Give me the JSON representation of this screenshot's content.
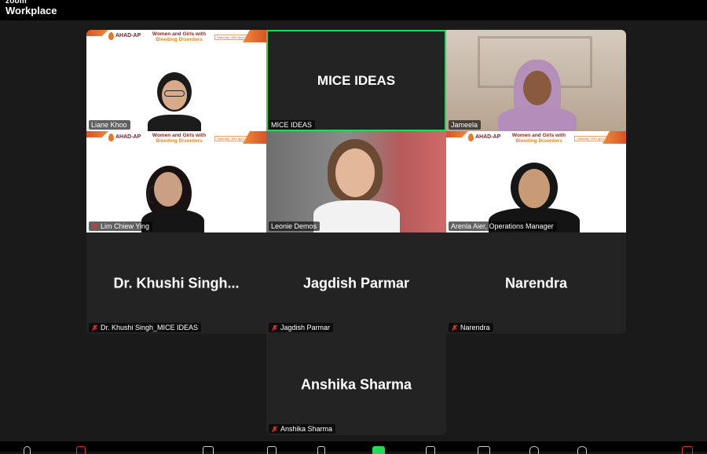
{
  "app": {
    "logo_line1": "zoom",
    "logo_line2": "Workplace"
  },
  "banner": {
    "org": "AHAD-AP",
    "title_line1": "Women and Girls with",
    "title_line2": "Bleeding Disorders",
    "date": "Saturday, 30th April 2024"
  },
  "participants": [
    {
      "name": "Liane Khoo",
      "muted": false,
      "video": true
    },
    {
      "name": "MICE IDEAS",
      "muted": false,
      "video": false,
      "display_text": "MICE IDEAS",
      "active_speaker": true
    },
    {
      "name": "Jameela",
      "muted": false,
      "video": true
    },
    {
      "name": "Lim Chiew Ying",
      "muted": true,
      "video": true
    },
    {
      "name": "Leonie Demos",
      "muted": false,
      "video": true
    },
    {
      "name": "Arenla Aier, Operations Manager",
      "muted": false,
      "video": true
    },
    {
      "name": "Dr. Khushi Singh_MICE IDEAS",
      "muted": true,
      "video": false,
      "display_text": "Dr. Khushi Singh..."
    },
    {
      "name": "Jagdish Parmar",
      "muted": true,
      "video": false,
      "display_text": "Jagdish Parmar"
    },
    {
      "name": "Narendra",
      "muted": true,
      "video": false,
      "display_text": "Narendra"
    },
    {
      "name": "Anshika Sharma",
      "muted": true,
      "video": false,
      "display_text": "Anshika Sharma"
    }
  ],
  "colors": {
    "active_speaker_border": "#23d959",
    "muted_icon": "#e0342b",
    "banner_accent": "#e07b2a"
  }
}
